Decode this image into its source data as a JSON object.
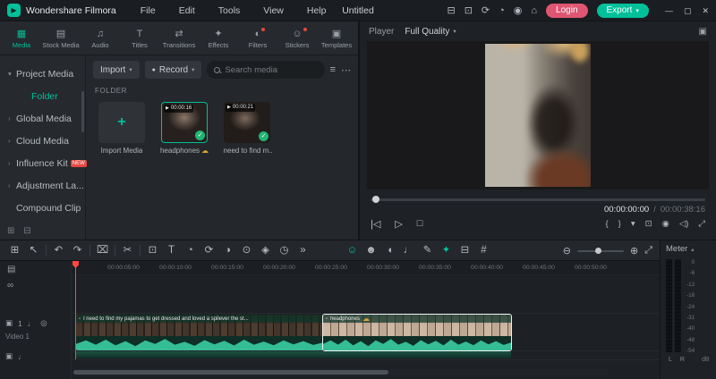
{
  "ui": {
    "caret": "▾",
    "logo_glyph": "▶",
    "record_glyph": "●",
    "filter_glyph": "≡",
    "more_glyph": "⋯",
    "plus_glyph": "+",
    "play_glyph": "▶",
    "check_glyph": "✓",
    "cloud_glyph": "☁",
    "clip_icon_glyph": "▫",
    "zoom_out": "⊖",
    "zoom_in": "⊕",
    "fit_glyph": "⤢",
    "meter_caret": "▴"
  },
  "titlebar": {
    "app_name": "Wondershare Filmora",
    "project_title": "Untitled",
    "menus": [
      {
        "label": "File"
      },
      {
        "label": "Edit"
      },
      {
        "label": "Tools"
      },
      {
        "label": "View"
      },
      {
        "label": "Help"
      }
    ],
    "right_icons": [
      {
        "name": "workspace-icon",
        "glyph": "⊟"
      },
      {
        "name": "display-icon",
        "glyph": "⊡"
      },
      {
        "name": "sync-icon",
        "glyph": "⟳"
      },
      {
        "name": "notification-icon",
        "glyph": "◔"
      },
      {
        "name": "account-icon",
        "glyph": "◉"
      },
      {
        "name": "cart-icon",
        "glyph": "⌂"
      }
    ],
    "login_label": "Login",
    "export_label": "Export",
    "window_icons": [
      {
        "name": "minimize-button",
        "glyph": "—"
      },
      {
        "name": "maximize-button",
        "glyph": "▢"
      },
      {
        "name": "close-button",
        "glyph": "✕"
      }
    ]
  },
  "tabbar": {
    "tabs": [
      {
        "label": "Media",
        "glyph": "▦",
        "active": true
      },
      {
        "label": "Stock Media",
        "glyph": "▤"
      },
      {
        "label": "Audio",
        "glyph": "♫"
      },
      {
        "label": "Titles",
        "glyph": "T"
      },
      {
        "label": "Transitions",
        "glyph": "⇄"
      },
      {
        "label": "Effects",
        "glyph": "✦"
      },
      {
        "label": "Filters",
        "glyph": "◐",
        "dot": true
      },
      {
        "label": "Stickers",
        "glyph": "☺",
        "dot": true
      },
      {
        "label": "Templates",
        "glyph": "▣"
      }
    ]
  },
  "sidebar": {
    "items": [
      {
        "label": "Project Media",
        "chev": "▾"
      },
      {
        "label": "Folder",
        "active": true,
        "indent": true,
        "chev": ""
      },
      {
        "label": "Global Media",
        "chev": "›"
      },
      {
        "label": "Cloud Media",
        "chev": "›"
      },
      {
        "label": "Influence Kit",
        "chev": "›",
        "badge": "NEW"
      },
      {
        "label": "Adjustment La...",
        "chev": "›"
      },
      {
        "label": "Compound Clip",
        "chev": ""
      }
    ],
    "footer_icons": [
      {
        "name": "new-folder-icon",
        "glyph": "⊞"
      },
      {
        "name": "delete-folder-icon",
        "glyph": "⊟"
      }
    ]
  },
  "media_panel": {
    "import_label": "Import",
    "record_label": "Record",
    "search_placeholder": "Search media",
    "section_label": "FOLDER",
    "import_tile_label": "Import Media",
    "clips": [
      {
        "label": "headphones",
        "duration": "00:00:16",
        "selected": true,
        "cloud": true,
        "type": "p1"
      },
      {
        "label": "I need to find m...",
        "duration": "00:00:21",
        "type": "p2"
      }
    ]
  },
  "player": {
    "label": "Player",
    "quality": "Full Quality",
    "current_time": "00:00:00:00",
    "time_separator": "/",
    "duration": "00:00:38:16",
    "transport": [
      {
        "name": "previous-frame-icon",
        "glyph": "|◁"
      },
      {
        "name": "play-icon",
        "glyph": "▷"
      },
      {
        "name": "stop-icon",
        "glyph": "□"
      }
    ],
    "tools": [
      {
        "name": "mark-in-icon",
        "glyph": "{"
      },
      {
        "name": "mark-out-icon",
        "glyph": "}"
      },
      {
        "name": "preview-quality-icon",
        "glyph": "▾"
      },
      {
        "name": "display-device-icon",
        "glyph": "⊡"
      },
      {
        "name": "snapshot-icon",
        "glyph": "◉"
      },
      {
        "name": "volume-icon",
        "glyph": "◁)"
      },
      {
        "name": "fullscreen-icon",
        "glyph": "⤢"
      }
    ]
  },
  "toolbar": {
    "icons": [
      {
        "name": "media-grid-icon",
        "glyph": "⊞"
      },
      {
        "name": "select-tool-icon",
        "glyph": "↖"
      },
      {
        "sep": true
      },
      {
        "name": "undo-icon",
        "glyph": "↶"
      },
      {
        "name": "redo-icon",
        "glyph": "↷"
      },
      {
        "sep": true
      },
      {
        "name": "delete-icon",
        "glyph": "⌧"
      },
      {
        "sep": true
      },
      {
        "name": "split-icon",
        "glyph": "✂"
      },
      {
        "sep": true
      },
      {
        "name": "crop-icon",
        "glyph": "⊡"
      },
      {
        "name": "text-icon",
        "glyph": "T"
      },
      {
        "name": "speed-icon",
        "glyph": "◔"
      },
      {
        "name": "rotate-icon",
        "glyph": "⟳"
      },
      {
        "name": "color-icon",
        "glyph": "◑"
      },
      {
        "name": "chroma-key-icon",
        "glyph": "⊙"
      },
      {
        "name": "keyframe-icon",
        "glyph": "◈"
      },
      {
        "name": "timer-icon",
        "glyph": "◷"
      },
      {
        "name": "more-tools-icon",
        "glyph": "»"
      },
      {
        "name": "ai-portrait-icon",
        "glyph": "☺",
        "accent": true,
        "gap": true
      },
      {
        "name": "person-cutout-icon",
        "glyph": "☻"
      },
      {
        "name": "mask-icon",
        "glyph": "◖"
      },
      {
        "name": "mic-icon",
        "glyph": "♩"
      },
      {
        "name": "edit-icon",
        "glyph": "✎"
      },
      {
        "name": "ai-magic-icon",
        "glyph": "✦",
        "accent": true
      },
      {
        "name": "render-icon",
        "glyph": "⊟"
      },
      {
        "name": "snap-icon",
        "glyph": "#"
      }
    ]
  },
  "timeline": {
    "manage_icon": "▤",
    "link_icon": "∞",
    "ruler": [
      "00:00:05:00",
      "00:00:10:00",
      "00:00:15:00",
      "00:00:20:00",
      "00:00:25:00",
      "00:00:30:00",
      "00:00:35:00",
      "00:00:40:00",
      "00:00:45:00",
      "00:00:50:00"
    ],
    "video_track": {
      "label": "Video 1",
      "icons": [
        {
          "name": "track-thumb-icon",
          "glyph": "▣"
        },
        {
          "name": "track-number",
          "glyph": "1"
        },
        {
          "name": "track-mute-icon",
          "glyph": "♩"
        },
        {
          "name": "track-hide-icon",
          "glyph": "◎"
        }
      ]
    },
    "audio_track": {
      "icons": [
        {
          "name": "track2-thumb-icon",
          "glyph": "▣"
        },
        {
          "name": "track2-mute-icon",
          "glyph": "♩"
        }
      ]
    },
    "clips": [
      {
        "label": "I need to find my pajamas to get dressed and loved a spilever the st...",
        "type": "crowd"
      },
      {
        "label": "headphones",
        "selected": true,
        "cloud": true,
        "type": "person"
      }
    ]
  },
  "meter": {
    "title": "Meter",
    "scale": [
      "0",
      "-6",
      "-12",
      "-18",
      "-24",
      "-31",
      "-40",
      "-48",
      "-54"
    ],
    "unit": "dB",
    "channel_left": "L",
    "channel_right": "R"
  }
}
